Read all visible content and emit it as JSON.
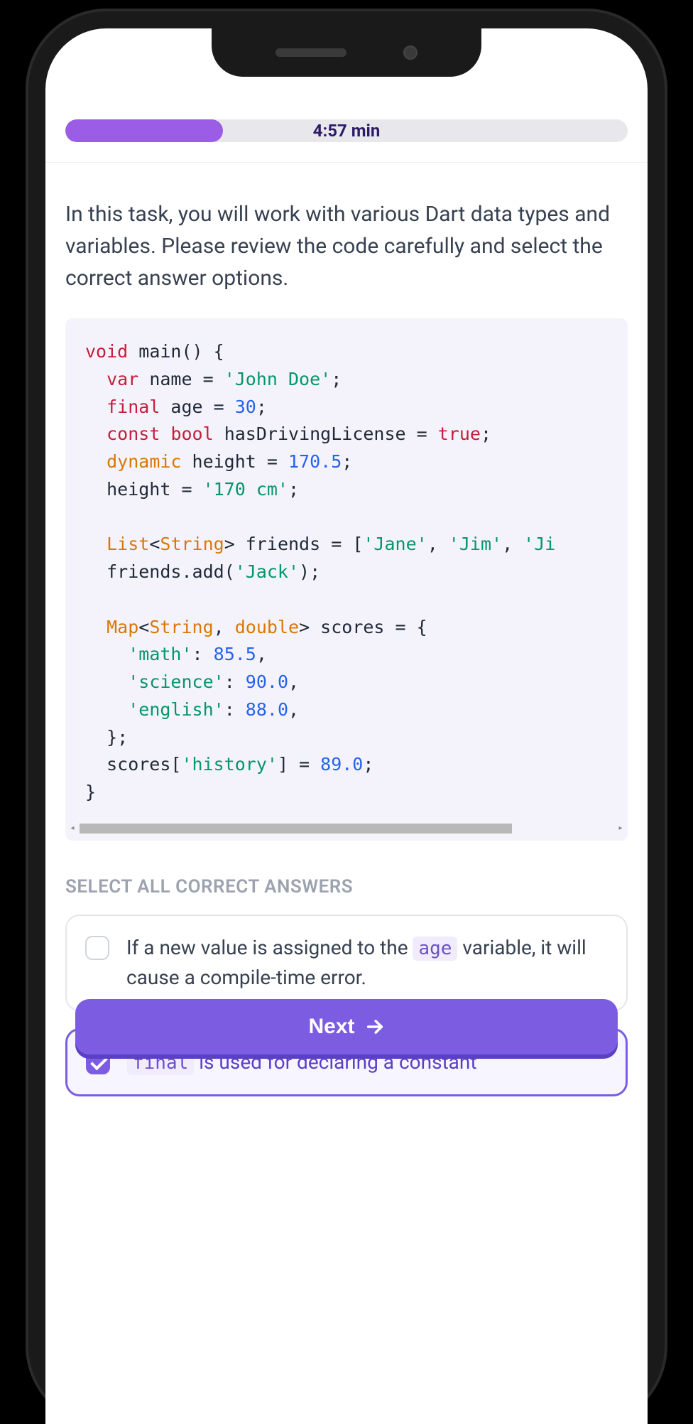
{
  "progress": {
    "timer": "4:57 min",
    "percent": 28
  },
  "instructions": "In this task, you will work with various Dart data types and variables. Please review the code carefully and select the correct answer options.",
  "code": {
    "lines": [
      [
        [
          "kw",
          "void"
        ],
        [
          "",
          " main() {"
        ]
      ],
      [
        [
          "",
          "  "
        ],
        [
          "kw",
          "var"
        ],
        [
          "",
          " name = "
        ],
        [
          "str",
          "'John Doe'"
        ],
        [
          "",
          ";"
        ]
      ],
      [
        [
          "",
          "  "
        ],
        [
          "kw",
          "final"
        ],
        [
          "",
          " age = "
        ],
        [
          "num",
          "30"
        ],
        [
          "",
          ";"
        ]
      ],
      [
        [
          "",
          "  "
        ],
        [
          "kw",
          "const"
        ],
        [
          "",
          " "
        ],
        [
          "kw",
          "bool"
        ],
        [
          "",
          " hasDrivingLicense = "
        ],
        [
          "bool",
          "true"
        ],
        [
          "",
          ";"
        ]
      ],
      [
        [
          "",
          "  "
        ],
        [
          "kw2",
          "dynamic"
        ],
        [
          "",
          " height = "
        ],
        [
          "num",
          "170.5"
        ],
        [
          "",
          ";"
        ]
      ],
      [
        [
          "",
          "  height = "
        ],
        [
          "str",
          "'170 cm'"
        ],
        [
          "",
          ";"
        ]
      ],
      [
        [
          "",
          ""
        ]
      ],
      [
        [
          "",
          "  "
        ],
        [
          "type",
          "List"
        ],
        [
          "",
          "<"
        ],
        [
          "type",
          "String"
        ],
        [
          "",
          "> friends = ["
        ],
        [
          "str",
          "'Jane'"
        ],
        [
          "",
          ", "
        ],
        [
          "str",
          "'Jim'"
        ],
        [
          "",
          ", "
        ],
        [
          "str",
          "'Ji"
        ]
      ],
      [
        [
          "",
          "  friends.add("
        ],
        [
          "str",
          "'Jack'"
        ],
        [
          "",
          ");"
        ]
      ],
      [
        [
          "",
          ""
        ]
      ],
      [
        [
          "",
          "  "
        ],
        [
          "type",
          "Map"
        ],
        [
          "",
          "<"
        ],
        [
          "type",
          "String"
        ],
        [
          "",
          ", "
        ],
        [
          "type",
          "double"
        ],
        [
          "",
          "> scores = {"
        ]
      ],
      [
        [
          "",
          "    "
        ],
        [
          "str",
          "'math'"
        ],
        [
          "",
          ": "
        ],
        [
          "num",
          "85.5"
        ],
        [
          "",
          ","
        ]
      ],
      [
        [
          "",
          "    "
        ],
        [
          "str",
          "'science'"
        ],
        [
          "",
          ": "
        ],
        [
          "num",
          "90.0"
        ],
        [
          "",
          ","
        ]
      ],
      [
        [
          "",
          "    "
        ],
        [
          "str",
          "'english'"
        ],
        [
          "",
          ": "
        ],
        [
          "num",
          "88.0"
        ],
        [
          "",
          ","
        ]
      ],
      [
        [
          "",
          "  };"
        ]
      ],
      [
        [
          "",
          "  scores["
        ],
        [
          "str",
          "'history'"
        ],
        [
          "",
          ""
        ],
        [
          "",
          "] = "
        ],
        [
          "num",
          "89.0"
        ],
        [
          "",
          ";"
        ]
      ],
      [
        [
          "",
          "}"
        ]
      ]
    ]
  },
  "section_title": "SELECT ALL CORRECT ANSWERS",
  "answers": [
    {
      "checked": false,
      "parts": [
        {
          "t": "If a new value is assigned to the "
        },
        {
          "t": "age",
          "code": true
        },
        {
          "t": " variable, it will cause a compile-time error."
        }
      ]
    },
    {
      "checked": true,
      "parts": [
        {
          "t": "final",
          "code": true
        },
        {
          "t": " is used for declaring a constant"
        }
      ]
    }
  ],
  "next_label": "Next"
}
